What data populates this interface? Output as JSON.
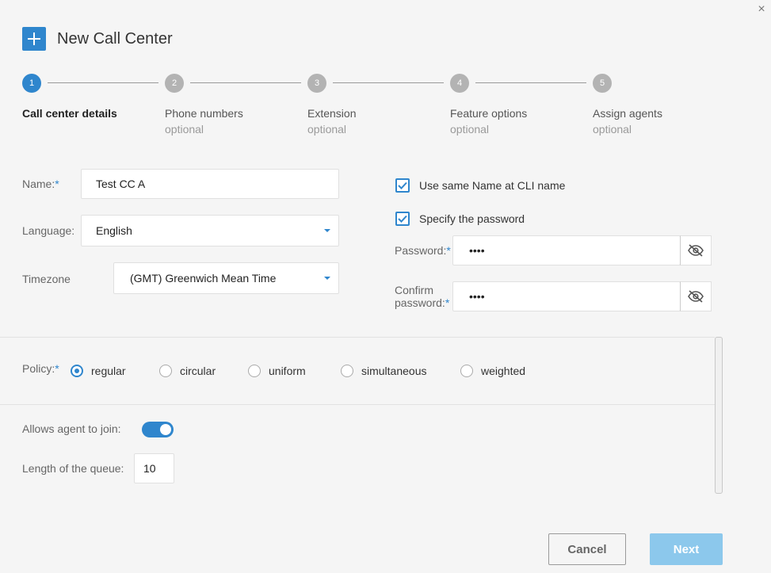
{
  "dialog": {
    "title": "New Call Center",
    "close_glyph": "×"
  },
  "stepper": {
    "steps": [
      {
        "number": "1",
        "title": "Call center details",
        "subtitle": ""
      },
      {
        "number": "2",
        "title": "Phone numbers",
        "subtitle": "optional"
      },
      {
        "number": "3",
        "title": "Extension",
        "subtitle": "optional"
      },
      {
        "number": "4",
        "title": "Feature options",
        "subtitle": "optional"
      },
      {
        "number": "5",
        "title": "Assign agents",
        "subtitle": "optional"
      }
    ],
    "active_step": 1
  },
  "form": {
    "name_label": "Name:",
    "name_value": "Test CC A",
    "language_label": "Language:",
    "language_value": "English",
    "timezone_label": "Timezone",
    "timezone_value": "(GMT) Greenwich Mean Time",
    "required_mark": "*",
    "same_name_label": "Use same Name at CLI name",
    "same_name_checked": true,
    "specify_password_label": "Specify the password",
    "specify_password_checked": true,
    "password_label": "Password:",
    "password_value": "••••",
    "confirm_label_line1": "Confirm",
    "confirm_label_line2": "password:",
    "confirm_value": "••••"
  },
  "policy": {
    "label": "Policy:",
    "options": [
      "regular",
      "circular",
      "uniform",
      "simultaneous",
      "weighted"
    ],
    "selected": "regular"
  },
  "queue": {
    "allow_join_label": "Allows agent to join:",
    "allow_join_on": true,
    "length_label": "Length of the queue:",
    "length_value": "10"
  },
  "footer": {
    "cancel_label": "Cancel",
    "next_label": "Next"
  },
  "colors": {
    "accent": "#2f86cd",
    "next_disabled": "#8cc8ec",
    "step_inactive": "#b3b3b3"
  },
  "icons": {
    "add": "plus-icon",
    "close": "close-icon",
    "password_toggle": "eye-slash-icon",
    "dropdown": "caret-down-icon",
    "check": "checkmark-icon"
  }
}
